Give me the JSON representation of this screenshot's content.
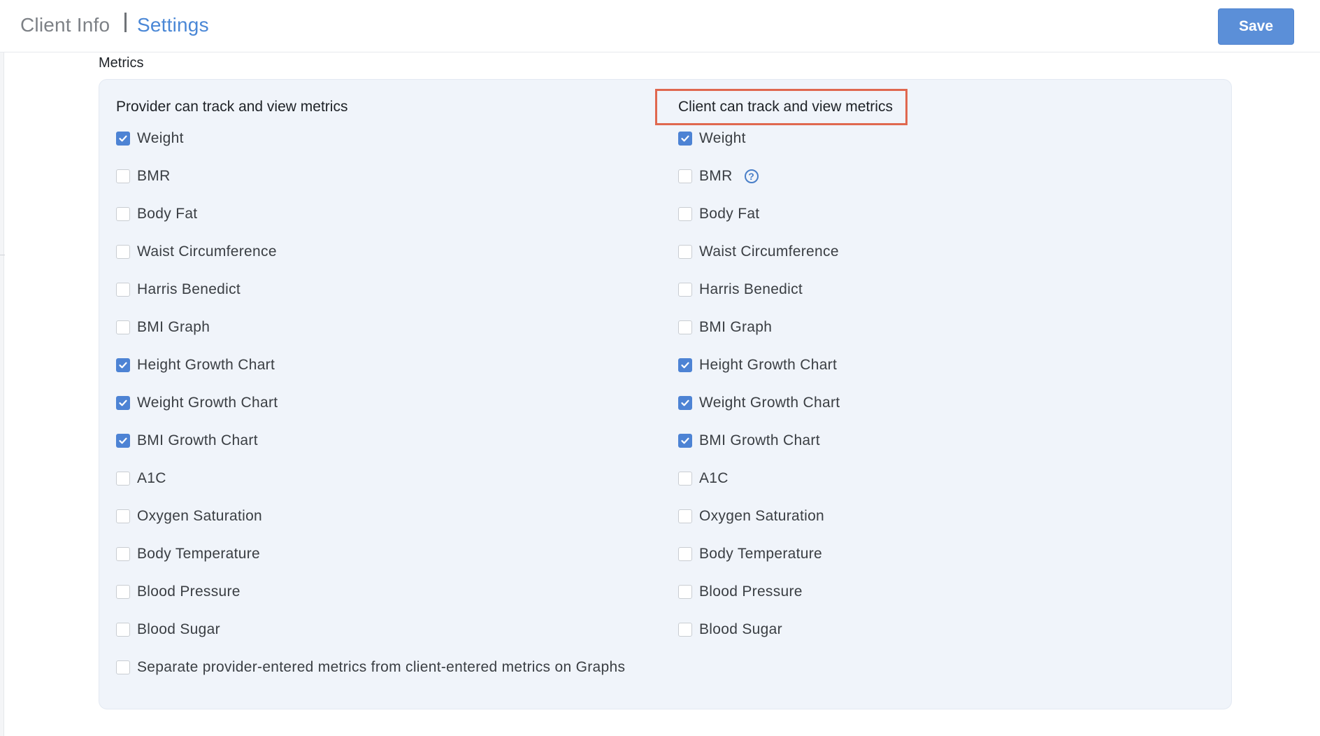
{
  "header": {
    "breadcrumb_parent": "Client Info",
    "breadcrumb_current": "Settings",
    "save_label": "Save"
  },
  "section": {
    "title": "Metrics"
  },
  "provider": {
    "heading": "Provider can track and view metrics",
    "items": [
      {
        "label": "Weight",
        "checked": true
      },
      {
        "label": "BMR",
        "checked": false
      },
      {
        "label": "Body Fat",
        "checked": false
      },
      {
        "label": "Waist Circumference",
        "checked": false
      },
      {
        "label": "Harris Benedict",
        "checked": false
      },
      {
        "label": "BMI Graph",
        "checked": false
      },
      {
        "label": "Height Growth Chart",
        "checked": true
      },
      {
        "label": "Weight Growth Chart",
        "checked": true
      },
      {
        "label": "BMI Growth Chart",
        "checked": true
      },
      {
        "label": "A1C",
        "checked": false
      },
      {
        "label": "Oxygen Saturation",
        "checked": false
      },
      {
        "label": "Body Temperature",
        "checked": false
      },
      {
        "label": "Blood Pressure",
        "checked": false
      },
      {
        "label": "Blood Sugar",
        "checked": false
      },
      {
        "label": "Separate provider-entered metrics from client-entered metrics on Graphs",
        "checked": false
      }
    ]
  },
  "client": {
    "heading": "Client can track and view metrics",
    "items": [
      {
        "label": "Weight",
        "checked": true
      },
      {
        "label": "BMR",
        "checked": false,
        "help": "?"
      },
      {
        "label": "Body Fat",
        "checked": false
      },
      {
        "label": "Waist Circumference",
        "checked": false
      },
      {
        "label": "Harris Benedict",
        "checked": false
      },
      {
        "label": "BMI Graph",
        "checked": false
      },
      {
        "label": "Height Growth Chart",
        "checked": true
      },
      {
        "label": "Weight Growth Chart",
        "checked": true
      },
      {
        "label": "BMI Growth Chart",
        "checked": true
      },
      {
        "label": "A1C",
        "checked": false
      },
      {
        "label": "Oxygen Saturation",
        "checked": false
      },
      {
        "label": "Body Temperature",
        "checked": false
      },
      {
        "label": "Blood Pressure",
        "checked": false
      },
      {
        "label": "Blood Sugar",
        "checked": false
      }
    ]
  },
  "colors": {
    "accent": "#4d83d4",
    "highlight": "#e0684f",
    "panel_bg": "#f0f4fa"
  }
}
